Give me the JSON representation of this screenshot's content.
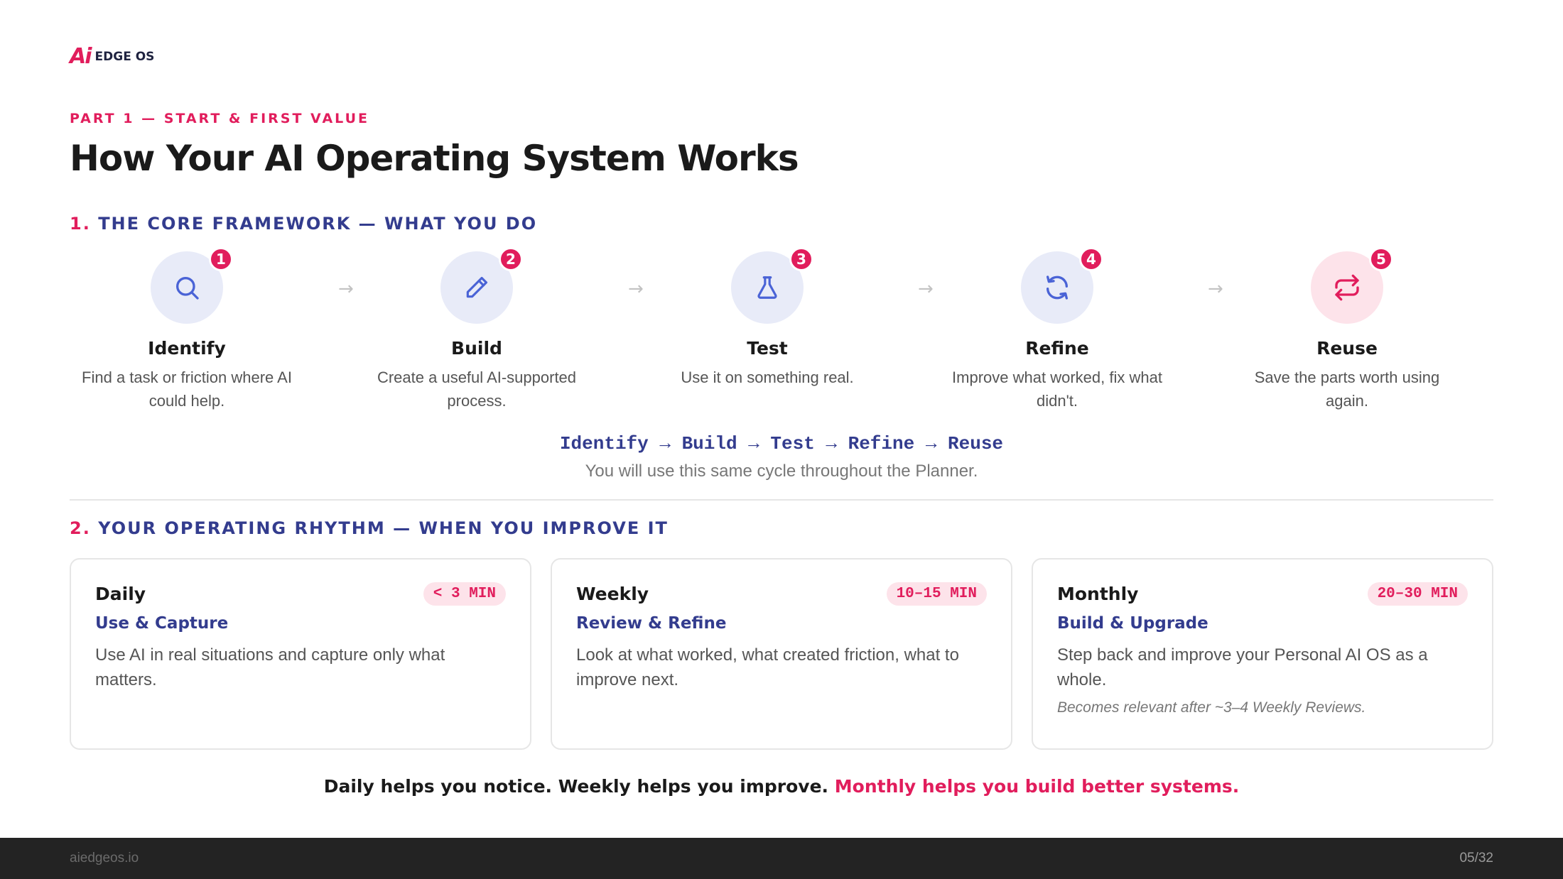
{
  "logo": {
    "mark": "Ai",
    "text": "EDGE OS"
  },
  "kicker": "PART 1 — START & FIRST VALUE",
  "title": "How Your AI Operating System Works",
  "section1": {
    "num": "1.",
    "label": "THE CORE FRAMEWORK — WHAT YOU DO"
  },
  "steps": [
    {
      "badge": "1",
      "name": "Identify",
      "desc": "Find a task or friction where AI could help.",
      "icon": "search-icon"
    },
    {
      "badge": "2",
      "name": "Build",
      "desc": "Create a useful AI-supported process.",
      "icon": "pencil-icon"
    },
    {
      "badge": "3",
      "name": "Test",
      "desc": "Use it on something real.",
      "icon": "flask-icon"
    },
    {
      "badge": "4",
      "name": "Refine",
      "desc": "Improve what worked, fix what didn't.",
      "icon": "refresh-icon"
    },
    {
      "badge": "5",
      "name": "Reuse",
      "desc": "Save the parts worth using again.",
      "icon": "repeat-icon"
    }
  ],
  "arrow": "→",
  "cycle": "Identify → Build → Test → Refine → Reuse",
  "cycle_note": "You will use this same cycle throughout the Planner.",
  "section2": {
    "num": "2.",
    "label": "YOUR OPERATING RHYTHM — WHEN YOU IMPROVE IT"
  },
  "cards": [
    {
      "title": "Daily",
      "pill": "< 3 MIN",
      "sub": "Use & Capture",
      "desc": "Use AI in real situations and capture only what matters.",
      "note": ""
    },
    {
      "title": "Weekly",
      "pill": "10–15 MIN",
      "sub": "Review & Refine",
      "desc": "Look at what worked, what created friction, what to improve next.",
      "note": ""
    },
    {
      "title": "Monthly",
      "pill": "20–30 MIN",
      "sub": "Build & Upgrade",
      "desc": "Step back and improve your Personal AI OS as a whole.",
      "note": "Becomes relevant after ~3–4 Weekly Reviews."
    }
  ],
  "tagline": {
    "dark": "Daily helps you notice. Weekly helps you improve. ",
    "pink": "Monthly helps you build better systems."
  },
  "footer": {
    "site": "aiedgeos.io",
    "page": "05/32"
  },
  "colors": {
    "accent": "#e11d5c",
    "navy": "#333c8e",
    "icon_bg": "#e8ebf8",
    "pink_bg": "#fde3ea",
    "footer_bg": "#232323"
  }
}
